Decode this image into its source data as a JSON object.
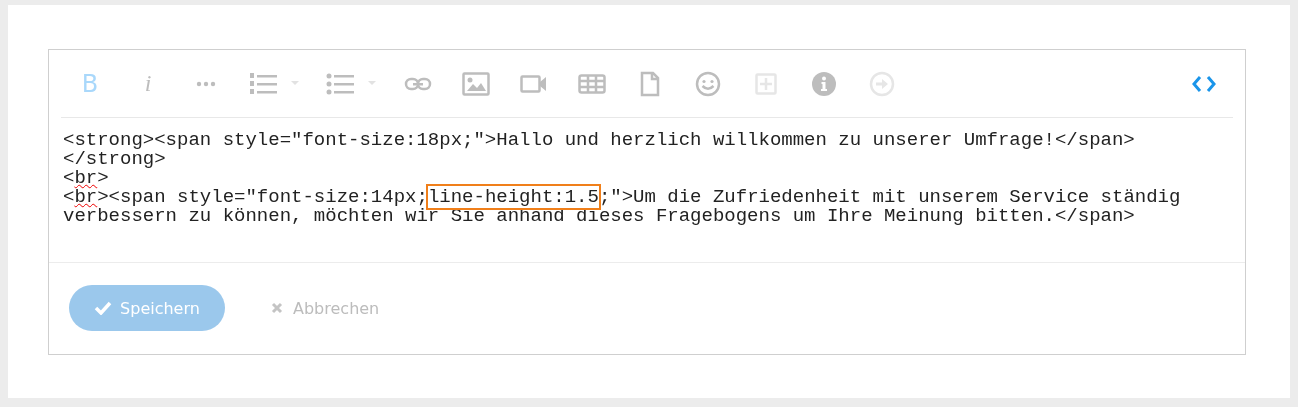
{
  "toolbar": [
    {
      "kind": "bold",
      "label": "B",
      "active": true,
      "disabled": false
    },
    {
      "kind": "italic",
      "label": "i",
      "active": false,
      "disabled": false
    },
    {
      "kind": "more",
      "active": false,
      "disabled": false
    },
    {
      "kind": "ordered-list",
      "active": false,
      "disabled": false
    },
    {
      "kind": "bullet-list",
      "active": false,
      "disabled": false
    },
    {
      "kind": "link",
      "active": false,
      "disabled": false
    },
    {
      "kind": "image",
      "active": false,
      "disabled": false
    },
    {
      "kind": "video",
      "active": false,
      "disabled": false
    },
    {
      "kind": "table",
      "active": false,
      "disabled": false
    },
    {
      "kind": "file",
      "active": false,
      "disabled": false
    },
    {
      "kind": "emoji",
      "active": false,
      "disabled": false
    },
    {
      "kind": "insert",
      "active": false,
      "disabled": true
    },
    {
      "kind": "info",
      "active": false,
      "disabled": false
    },
    {
      "kind": "next",
      "active": false,
      "disabled": true
    },
    {
      "kind": "code",
      "active": true,
      "disabled": false
    }
  ],
  "source_lines": [
    [
      {
        "text": "<strong><span style=\"font-size:18px;\">Hallo und herzlich willkommen zu unserer Umfrage!</span>",
        "misspelled": false,
        "highlighted": false
      }
    ],
    [
      {
        "text": "</strong>",
        "misspelled": false,
        "highlighted": false
      }
    ],
    [
      {
        "text": "<",
        "misspelled": false,
        "highlighted": false
      },
      {
        "text": "br",
        "misspelled": true,
        "highlighted": false
      },
      {
        "text": ">",
        "misspelled": false,
        "highlighted": false
      }
    ],
    [
      {
        "text": "<",
        "misspelled": false,
        "highlighted": false
      },
      {
        "text": "br",
        "misspelled": true,
        "highlighted": false
      },
      {
        "text": "><span style=\"font-size:14px;",
        "misspelled": false,
        "highlighted": false
      },
      {
        "text": "line-height:1.5",
        "misspelled": false,
        "highlighted": true
      },
      {
        "text": ";\">Um die Zufriedenheit mit unserem Service ständig verbessern zu können, möchten wir Sie anhand dieses Fragebogens um Ihre Meinung bitten.</span>",
        "misspelled": false,
        "highlighted": false
      }
    ]
  ],
  "buttons": [
    {
      "kind": "save",
      "label": "Speichern"
    },
    {
      "kind": "cancel",
      "label": "Abbrechen"
    }
  ]
}
